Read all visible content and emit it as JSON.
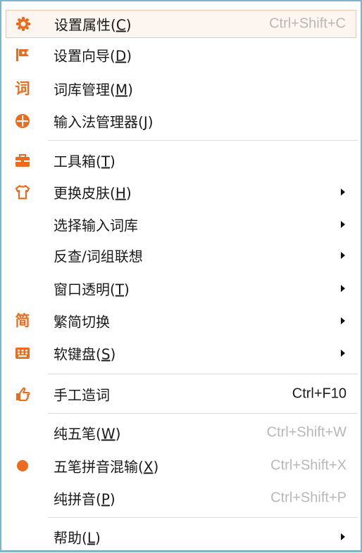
{
  "menu": {
    "items": [
      {
        "label": "设置属性(",
        "mn": "C",
        "suffix": ")",
        "shortcut": "Ctrl+Shift+C",
        "icon": "gear-icon"
      },
      {
        "label": "设置向导(",
        "mn": "D",
        "suffix": ")",
        "icon": "flag-icon"
      },
      {
        "label": "词库管理(",
        "mn": "M",
        "suffix": ")",
        "icon": "ci-glyph-icon",
        "icon_glyph": "词"
      },
      {
        "label": "输入法管理器(",
        "mn": "J",
        "suffix": ")",
        "icon": "circle-grid-icon"
      },
      {
        "label": "工具箱(",
        "mn": "T",
        "suffix": ")",
        "icon": "toolbox-icon"
      },
      {
        "label": "更换皮肤(",
        "mn": "H",
        "suffix": ")",
        "icon": "shirt-icon"
      },
      {
        "label": "选择输入词库"
      },
      {
        "label": "反查/词组联想"
      },
      {
        "label": "窗口透明(",
        "mn": "T",
        "suffix": ")"
      },
      {
        "label": "繁简切换",
        "icon": "jian-glyph-icon",
        "icon_glyph": "简"
      },
      {
        "label": "软键盘(",
        "mn": "S",
        "suffix": ")",
        "icon": "keyboard-icon"
      },
      {
        "label": "手工造词",
        "shortcut": "Ctrl+F10",
        "icon": "pointing-hand-icon"
      },
      {
        "label": "纯五笔(",
        "mn": "W",
        "suffix": ")",
        "shortcut": "Ctrl+Shift+W"
      },
      {
        "label": "五笔拼音混输(",
        "mn": "X",
        "suffix": ")",
        "shortcut": "Ctrl+Shift+X",
        "icon": "selected-dot-icon"
      },
      {
        "label": "纯拼音(",
        "mn": "P",
        "suffix": ")",
        "shortcut": "Ctrl+Shift+P"
      },
      {
        "label": "帮助(",
        "mn": "L",
        "suffix": ")"
      }
    ]
  },
  "colors": {
    "accent": "#ec6b1d",
    "highlight_bg": "#fdf5ef",
    "highlight_border": "#f2c6a8",
    "shortcut_gray": "#b8b8b8",
    "frame": "#7fb4cc"
  }
}
